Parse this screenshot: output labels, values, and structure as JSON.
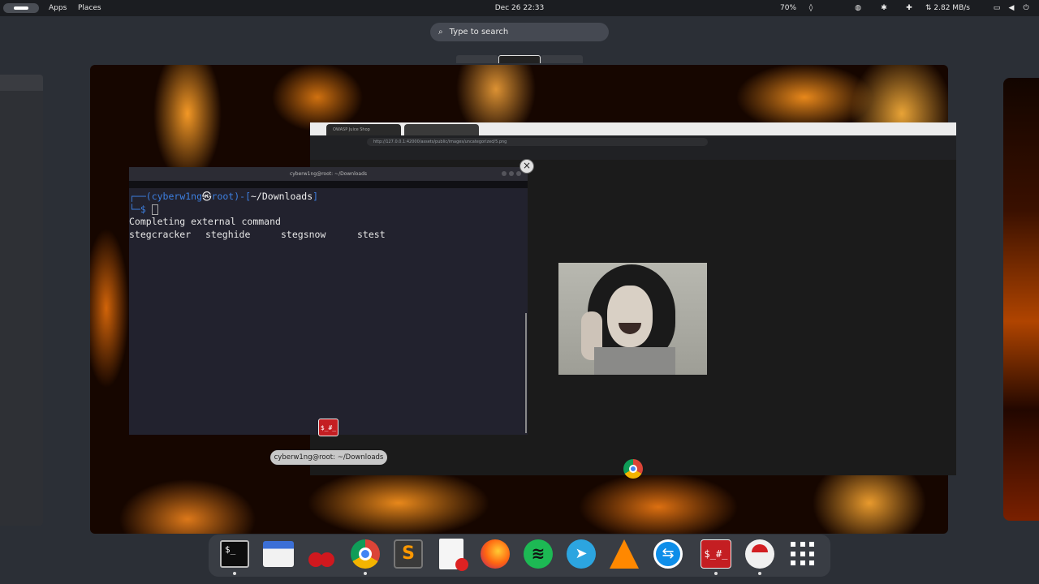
{
  "topbar": {
    "apps": "Apps",
    "places": "Places",
    "clock": "Dec 26  22:33",
    "battery": "70%",
    "network": "⇅ 2.82 MB/s"
  },
  "search": {
    "placeholder": "Type to search"
  },
  "terminal": {
    "title": "cyberw1ng@root: ~/Downloads",
    "prompt_user": "cyberw1ng",
    "prompt_host": "root",
    "prompt_dir": "~/Downloads",
    "prompt_line1_open": "┌──(",
    "prompt_line1_at": "㉿",
    "prompt_line1_mid": ")-[",
    "prompt_line1_close": "]",
    "prompt_line2": "└─$",
    "completion_header": "Completing external command",
    "completions": [
      "stegcracker",
      "steghide",
      "stegsnow",
      "stest"
    ],
    "app_icon_text": "$_#_",
    "label": "cyberw1ng@root: ~/Downloads"
  },
  "chrome": {
    "tab1": "OWASP Juice Shop",
    "tab2": "",
    "url": "http://127.0.0.1:42000/assets/public/images/uncategorized/5.png"
  },
  "dock": {
    "items": [
      {
        "name": "terminal",
        "text": "$_"
      },
      {
        "name": "files"
      },
      {
        "name": "cherrytree"
      },
      {
        "name": "chrome"
      },
      {
        "name": "sublime",
        "text": "S"
      },
      {
        "name": "text-editor"
      },
      {
        "name": "firefox"
      },
      {
        "name": "spotify"
      },
      {
        "name": "telegram"
      },
      {
        "name": "vlc"
      },
      {
        "name": "teamviewer"
      },
      {
        "name": "kali-terminal",
        "text": "$_#_"
      },
      {
        "name": "installer"
      },
      {
        "name": "app-grid"
      }
    ]
  },
  "colors": {
    "topbar": "#1b1d21",
    "terminal_bg": "#22222e",
    "prompt_blue": "#3d7fe0",
    "kali_red": "#c41e22"
  }
}
